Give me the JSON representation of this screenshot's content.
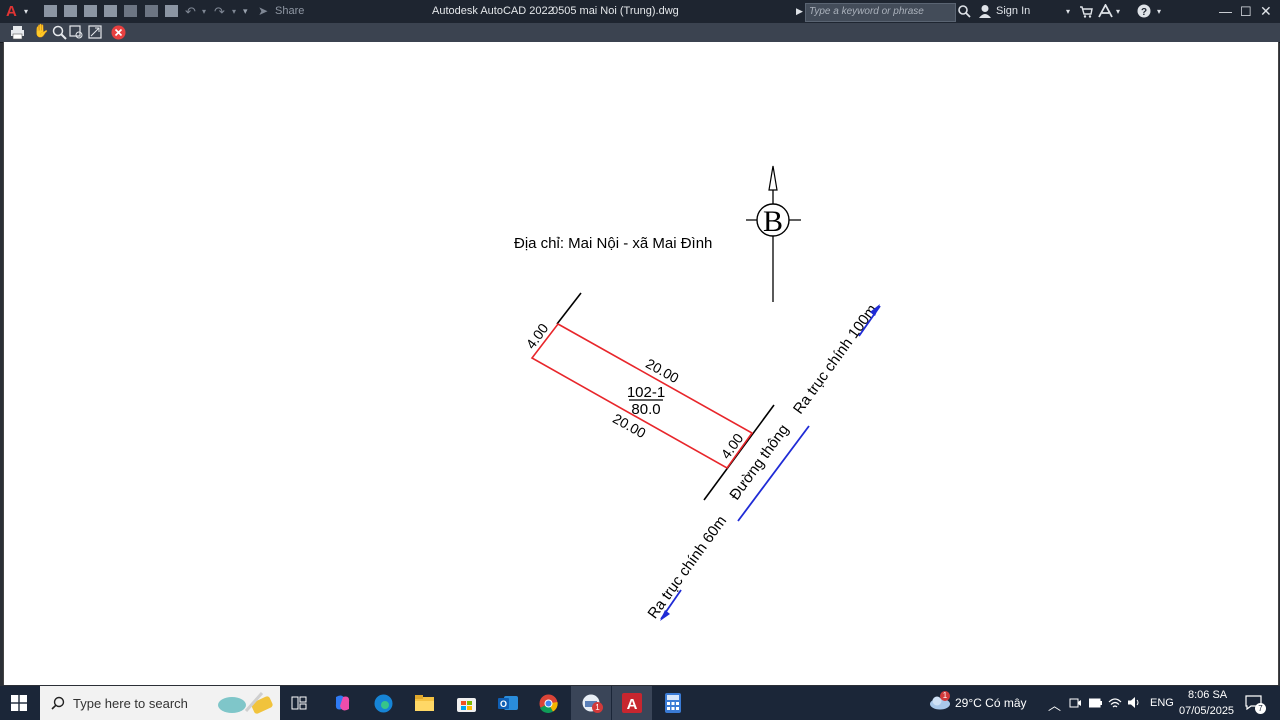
{
  "titlebar": {
    "app_title": "Autodesk AutoCAD 2022",
    "file_name": "0505 mai Noi (Trung).dwg",
    "share_label": "Share",
    "search_placeholder": "Type a keyword or phrase",
    "sign_in_label": "Sign In"
  },
  "drawing": {
    "address": "Địa chỉ: Mai Nội - xã Mai Đình",
    "north_label": "B",
    "parcel_id": "102-1",
    "parcel_area": "80.0",
    "dim_top_left": "4.00",
    "dim_top_side": "20.00",
    "dim_bottom_side": "20.00",
    "dim_bottom_right": "4.00",
    "road_label": "Đường thông",
    "road_top_label": "Ra trục chính 100m",
    "road_bottom_label": "Ra trục chính 60m",
    "colors": {
      "parcel": "#e8262b",
      "road_arrow": "#1f2bd6",
      "line": "#000000"
    }
  },
  "taskbar": {
    "search_placeholder": "Type here to search",
    "weather": "29°C  Có mây",
    "weather_badge": "1",
    "language": "ENG",
    "time": "8:06 SA",
    "date": "07/05/2025",
    "notification_count": "7",
    "mail_badge": "1"
  }
}
